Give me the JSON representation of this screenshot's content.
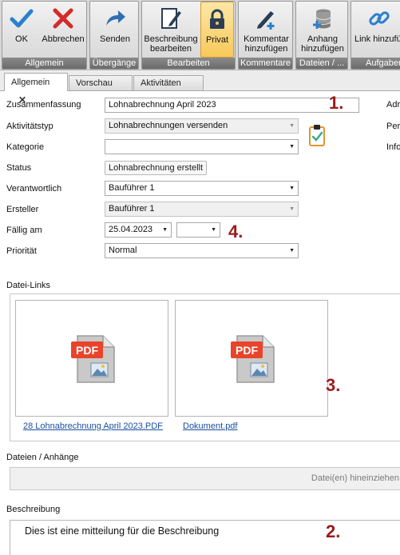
{
  "ribbon": {
    "groups": {
      "allgemein": "Allgemein",
      "uebergaenge": "Übergänge",
      "bearbeiten": "Bearbeiten",
      "kommentare": "Kommentare",
      "dateien": "Dateien / ...",
      "aufgaben": "Aufgaben"
    },
    "buttons": {
      "ok": "OK",
      "abbrechen": "Abbrechen",
      "senden": "Senden",
      "beschreibung": "Beschreibung\nbearbeiten",
      "privat": "Privat",
      "kommentar": "Kommentar\nhinzufügen",
      "anhang": "Anhang\nhinzufügen",
      "link": "Link hinzufügen"
    }
  },
  "tabs": {
    "allgemein": "Allgemein",
    "vorschau": "Vorschau",
    "aktivitaeten": "Aktivitäten"
  },
  "form": {
    "zusammenfassung": {
      "label": "Zusammenfassung",
      "value": "Lohnabrechnung April 2023"
    },
    "aktivitaetstyp": {
      "label": "Aktivitätstyp",
      "value": "Lohnabrechnungen versenden"
    },
    "kategorie": {
      "label": "Kategorie",
      "value": ""
    },
    "status": {
      "label": "Status",
      "value": "Lohnabrechnung erstellt"
    },
    "verantwortlich": {
      "label": "Verantwortlich",
      "value": "Bauführer 1"
    },
    "ersteller": {
      "label": "Ersteller",
      "value": "Bauführer 1"
    },
    "faellig": {
      "label": "Fällig am",
      "date": "25.04.2023",
      "time": ""
    },
    "prioritaet": {
      "label": "Priorität",
      "value": "Normal"
    }
  },
  "right_labels": {
    "adr": "Adr",
    "per": "Per",
    "info": "Info"
  },
  "annotations": {
    "a1": "1.",
    "a2": "2.",
    "a3": "3.",
    "a4": "4."
  },
  "datei_links": {
    "title": "Datei-Links",
    "files": [
      {
        "name": "28 Lohnabrechnung April 2023.PDF",
        "badge": "PDF"
      },
      {
        "name": "Dokument.pdf",
        "badge": "PDF"
      }
    ]
  },
  "anhaenge": {
    "title": "Dateien / Anhänge",
    "drop_text": "Datei(en) hineinziehen"
  },
  "beschreibung": {
    "title": "Beschreibung",
    "text": "Dies ist eine mitteilung für die Beschreibung"
  },
  "colors": {
    "accent_blue": "#2a7fd0",
    "cancel_red": "#d42a2a",
    "annotation_red": "#9b1b1b",
    "privat_active": "#f7c95a"
  }
}
